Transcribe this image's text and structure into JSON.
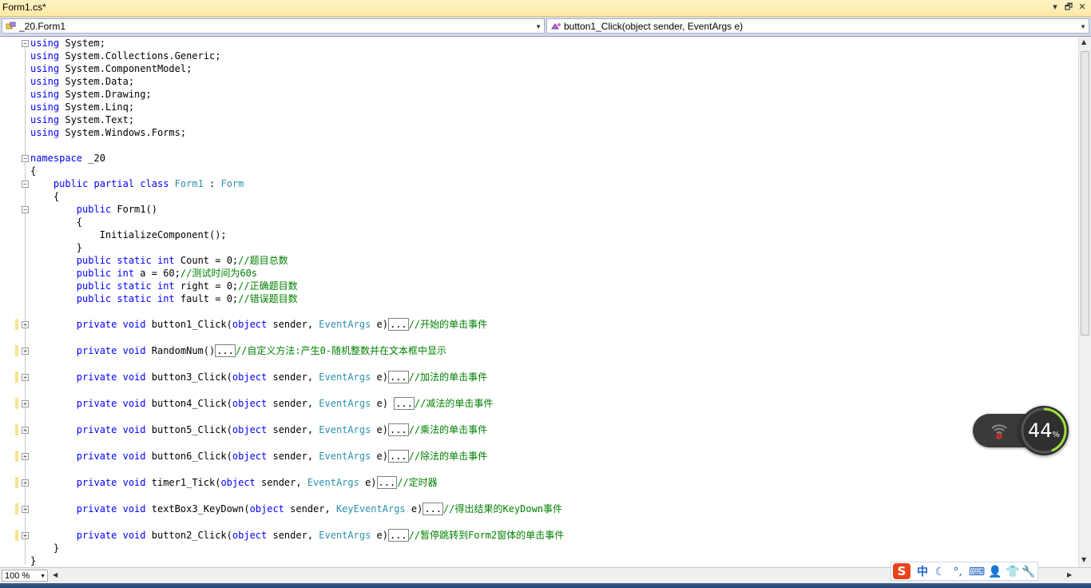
{
  "window": {
    "tab_title": "Form1.cs*",
    "buttons": {
      "dropdown": "▾",
      "restore": "🗗",
      "close": "✕"
    }
  },
  "navbar": {
    "types_combo": "_20.Form1",
    "members_combo": "button1_Click(object sender, EventArgs e)"
  },
  "code": {
    "lines": [
      [
        {
          "t": "using",
          "c": "kw"
        },
        {
          "t": " System;",
          "c": ""
        }
      ],
      [
        {
          "t": "using",
          "c": "kw"
        },
        {
          "t": " System.Collections.Generic;",
          "c": ""
        }
      ],
      [
        {
          "t": "using",
          "c": "kw"
        },
        {
          "t": " System.ComponentModel;",
          "c": ""
        }
      ],
      [
        {
          "t": "using",
          "c": "kw"
        },
        {
          "t": " System.Data;",
          "c": ""
        }
      ],
      [
        {
          "t": "using",
          "c": "kw"
        },
        {
          "t": " System.Drawing;",
          "c": ""
        }
      ],
      [
        {
          "t": "using",
          "c": "kw"
        },
        {
          "t": " System.Linq;",
          "c": ""
        }
      ],
      [
        {
          "t": "using",
          "c": "kw"
        },
        {
          "t": " System.Text;",
          "c": ""
        }
      ],
      [
        {
          "t": "using",
          "c": "kw"
        },
        {
          "t": " System.Windows.Forms;",
          "c": ""
        }
      ],
      [],
      [
        {
          "t": "namespace",
          "c": "kw"
        },
        {
          "t": " _20",
          "c": ""
        }
      ],
      [
        {
          "t": "{",
          "c": ""
        }
      ],
      [
        {
          "t": "    ",
          "c": ""
        },
        {
          "t": "public",
          "c": "kw"
        },
        {
          "t": " ",
          "c": ""
        },
        {
          "t": "partial",
          "c": "kw"
        },
        {
          "t": " ",
          "c": ""
        },
        {
          "t": "class",
          "c": "kw"
        },
        {
          "t": " ",
          "c": ""
        },
        {
          "t": "Form1",
          "c": "ty"
        },
        {
          "t": " : ",
          "c": ""
        },
        {
          "t": "Form",
          "c": "ty"
        }
      ],
      [
        {
          "t": "    {",
          "c": ""
        }
      ],
      [
        {
          "t": "        ",
          "c": ""
        },
        {
          "t": "public",
          "c": "kw"
        },
        {
          "t": " Form1()",
          "c": ""
        }
      ],
      [
        {
          "t": "        {",
          "c": ""
        }
      ],
      [
        {
          "t": "            InitializeComponent();",
          "c": ""
        }
      ],
      [
        {
          "t": "        }",
          "c": ""
        }
      ],
      [
        {
          "t": "        ",
          "c": ""
        },
        {
          "t": "public",
          "c": "kw"
        },
        {
          "t": " ",
          "c": ""
        },
        {
          "t": "static",
          "c": "kw"
        },
        {
          "t": " ",
          "c": ""
        },
        {
          "t": "int",
          "c": "kw"
        },
        {
          "t": " Count = 0;",
          "c": ""
        },
        {
          "t": "//题目总数",
          "c": "cm"
        }
      ],
      [
        {
          "t": "        ",
          "c": ""
        },
        {
          "t": "public",
          "c": "kw"
        },
        {
          "t": " ",
          "c": ""
        },
        {
          "t": "int",
          "c": "kw"
        },
        {
          "t": " a = 60;",
          "c": ""
        },
        {
          "t": "//测试时间为60s",
          "c": "cm"
        }
      ],
      [
        {
          "t": "        ",
          "c": ""
        },
        {
          "t": "public",
          "c": "kw"
        },
        {
          "t": " ",
          "c": ""
        },
        {
          "t": "static",
          "c": "kw"
        },
        {
          "t": " ",
          "c": ""
        },
        {
          "t": "int",
          "c": "kw"
        },
        {
          "t": " right = 0;",
          "c": ""
        },
        {
          "t": "//正确题目数",
          "c": "cm"
        }
      ],
      [
        {
          "t": "        ",
          "c": ""
        },
        {
          "t": "public",
          "c": "kw"
        },
        {
          "t": " ",
          "c": ""
        },
        {
          "t": "static",
          "c": "kw"
        },
        {
          "t": " ",
          "c": ""
        },
        {
          "t": "int",
          "c": "kw"
        },
        {
          "t": " fault = 0;",
          "c": ""
        },
        {
          "t": "//错误题目数",
          "c": "cm"
        }
      ]
    ],
    "methods": [
      [
        {
          "t": "        ",
          "c": ""
        },
        {
          "t": "private",
          "c": "kw"
        },
        {
          "t": " ",
          "c": ""
        },
        {
          "t": "void",
          "c": "kw"
        },
        {
          "t": " button1_Click(",
          "c": ""
        },
        {
          "t": "object",
          "c": "kw"
        },
        {
          "t": " sender, ",
          "c": ""
        },
        {
          "t": "EventArgs",
          "c": "ty"
        },
        {
          "t": " e)",
          "c": ""
        },
        {
          "t": "...",
          "c": "box"
        },
        {
          "t": "//开始的单击事件",
          "c": "cm"
        }
      ],
      [
        {
          "t": "        ",
          "c": ""
        },
        {
          "t": "private",
          "c": "kw"
        },
        {
          "t": " ",
          "c": ""
        },
        {
          "t": "void",
          "c": "kw"
        },
        {
          "t": " RandomNum()",
          "c": ""
        },
        {
          "t": "...",
          "c": "box"
        },
        {
          "t": "//自定义方法:产生0-随机整数并在文本框中显示",
          "c": "cm"
        }
      ],
      [
        {
          "t": "        ",
          "c": ""
        },
        {
          "t": "private",
          "c": "kw"
        },
        {
          "t": " ",
          "c": ""
        },
        {
          "t": "void",
          "c": "kw"
        },
        {
          "t": " button3_Click(",
          "c": ""
        },
        {
          "t": "object",
          "c": "kw"
        },
        {
          "t": " sender, ",
          "c": ""
        },
        {
          "t": "EventArgs",
          "c": "ty"
        },
        {
          "t": " e)",
          "c": ""
        },
        {
          "t": "...",
          "c": "box"
        },
        {
          "t": "//加法的单击事件",
          "c": "cm"
        }
      ],
      [
        {
          "t": "        ",
          "c": ""
        },
        {
          "t": "private",
          "c": "kw"
        },
        {
          "t": " ",
          "c": ""
        },
        {
          "t": "void",
          "c": "kw"
        },
        {
          "t": " button4_Click(",
          "c": ""
        },
        {
          "t": "object",
          "c": "kw"
        },
        {
          "t": " sender, ",
          "c": ""
        },
        {
          "t": "EventArgs",
          "c": "ty"
        },
        {
          "t": " e) ",
          "c": ""
        },
        {
          "t": "...",
          "c": "box"
        },
        {
          "t": "//减法的单击事件",
          "c": "cm"
        }
      ],
      [
        {
          "t": "        ",
          "c": ""
        },
        {
          "t": "private",
          "c": "kw"
        },
        {
          "t": " ",
          "c": ""
        },
        {
          "t": "void",
          "c": "kw"
        },
        {
          "t": " button5_Click(",
          "c": ""
        },
        {
          "t": "object",
          "c": "kw"
        },
        {
          "t": " sender, ",
          "c": ""
        },
        {
          "t": "EventArgs",
          "c": "ty"
        },
        {
          "t": " e)",
          "c": ""
        },
        {
          "t": "...",
          "c": "box"
        },
        {
          "t": "//乘法的单击事件",
          "c": "cm"
        }
      ],
      [
        {
          "t": "        ",
          "c": ""
        },
        {
          "t": "private",
          "c": "kw"
        },
        {
          "t": " ",
          "c": ""
        },
        {
          "t": "void",
          "c": "kw"
        },
        {
          "t": " button6_Click(",
          "c": ""
        },
        {
          "t": "object",
          "c": "kw"
        },
        {
          "t": " sender, ",
          "c": ""
        },
        {
          "t": "EventArgs",
          "c": "ty"
        },
        {
          "t": " e)",
          "c": ""
        },
        {
          "t": "...",
          "c": "box"
        },
        {
          "t": "//除法的单击事件",
          "c": "cm"
        }
      ],
      [
        {
          "t": "        ",
          "c": ""
        },
        {
          "t": "private",
          "c": "kw"
        },
        {
          "t": " ",
          "c": ""
        },
        {
          "t": "void",
          "c": "kw"
        },
        {
          "t": " timer1_Tick(",
          "c": ""
        },
        {
          "t": "object",
          "c": "kw"
        },
        {
          "t": " sender, ",
          "c": ""
        },
        {
          "t": "EventArgs",
          "c": "ty"
        },
        {
          "t": " e)",
          "c": ""
        },
        {
          "t": "...",
          "c": "box"
        },
        {
          "t": "//定时器",
          "c": "cm"
        }
      ],
      [
        {
          "t": "        ",
          "c": ""
        },
        {
          "t": "private",
          "c": "kw"
        },
        {
          "t": " ",
          "c": ""
        },
        {
          "t": "void",
          "c": "kw"
        },
        {
          "t": " textBox3_KeyDown(",
          "c": ""
        },
        {
          "t": "object",
          "c": "kw"
        },
        {
          "t": " sender, ",
          "c": ""
        },
        {
          "t": "KeyEventArgs",
          "c": "ty"
        },
        {
          "t": " e)",
          "c": ""
        },
        {
          "t": "...",
          "c": "box"
        },
        {
          "t": "//得出结果的KeyDown事件",
          "c": "cm"
        }
      ],
      [
        {
          "t": "        ",
          "c": ""
        },
        {
          "t": "private",
          "c": "kw"
        },
        {
          "t": " ",
          "c": ""
        },
        {
          "t": "void",
          "c": "kw"
        },
        {
          "t": " button2_Click(",
          "c": ""
        },
        {
          "t": "object",
          "c": "kw"
        },
        {
          "t": " sender, ",
          "c": ""
        },
        {
          "t": "EventArgs",
          "c": "ty"
        },
        {
          "t": " e)",
          "c": ""
        },
        {
          "t": "...",
          "c": "box"
        },
        {
          "t": "//暂停跳转到Form2窗体的单击事件",
          "c": "cm"
        }
      ]
    ],
    "closing": [
      "    }",
      "}"
    ]
  },
  "statusbar": {
    "zoom": "100 %"
  },
  "ime": {
    "logo": "S",
    "mode": "中",
    "items": [
      "☾",
      "°,",
      "⌨",
      "👤",
      "👕",
      "🔧"
    ]
  },
  "network_widget": {
    "percent": 44,
    "percent_text": "44",
    "unit": "%"
  },
  "colors": {
    "keyword": "#0000ff",
    "type": "#2b91af",
    "comment": "#008000",
    "change_marker": "#f6e58d",
    "tab_bg": "#ffe8a6"
  }
}
